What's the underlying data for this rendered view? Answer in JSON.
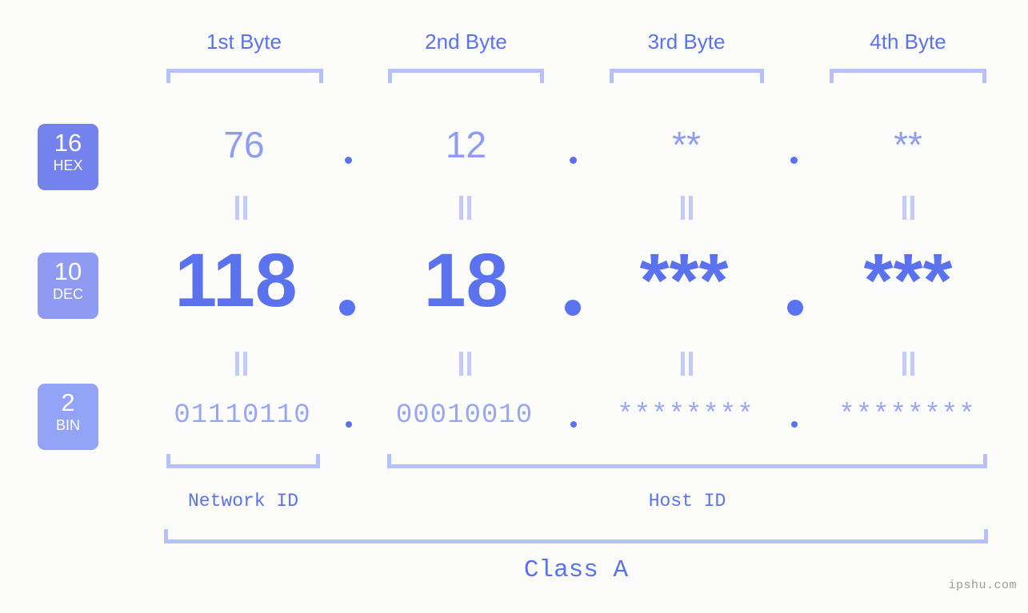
{
  "background_color": "#fcfdfa",
  "accent_color": "#5b72ee",
  "muted_accent_color": "#96a4f5",
  "bracket_color": "#b6c0fb",
  "columns": [
    {
      "header": "1st Byte"
    },
    {
      "header": "2nd Byte"
    },
    {
      "header": "3rd Byte"
    },
    {
      "header": "4th Byte"
    }
  ],
  "rows": [
    {
      "badge_number": "16",
      "badge_name": "HEX",
      "badge_color": "#7482ee",
      "values": [
        "76",
        "12",
        "**",
        "**"
      ]
    },
    {
      "badge_number": "10",
      "badge_name": "DEC",
      "badge_color": "#8f9bf3",
      "values": [
        "118",
        "18",
        "***",
        "***"
      ]
    },
    {
      "badge_number": "2",
      "badge_name": "BIN",
      "badge_color": "#93a3f6",
      "values": [
        "01110110",
        "00010010",
        "********",
        "********"
      ]
    }
  ],
  "separators": {
    "symbol": "."
  },
  "equality_symbol": "||",
  "id_labels": [
    {
      "label": "Network ID"
    },
    {
      "label": "Host ID"
    }
  ],
  "class_label": "Class A",
  "watermark": "ipshu.com"
}
